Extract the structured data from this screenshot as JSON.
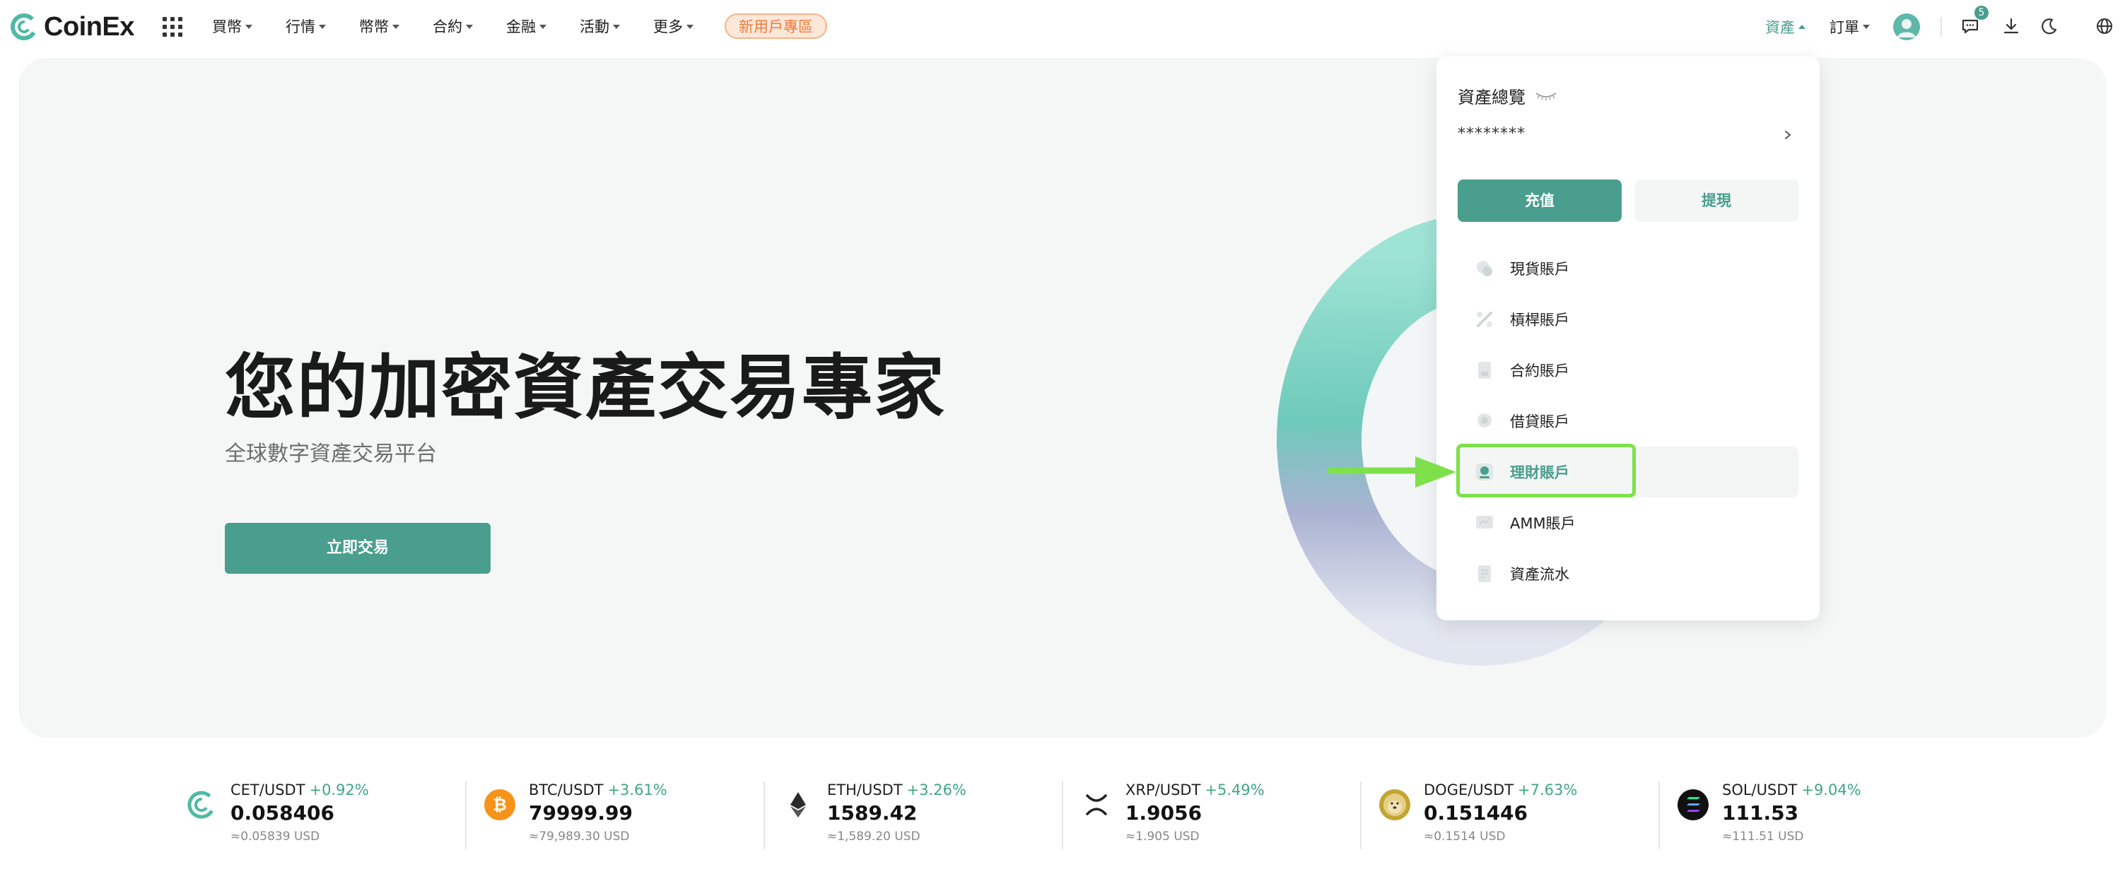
{
  "brand": {
    "name": "CoinEx",
    "color": "#4a9e8e"
  },
  "nav": {
    "items": [
      "買幣",
      "行情",
      "幣幣",
      "合約",
      "金融",
      "活動",
      "更多"
    ],
    "promo": "新用戶專區",
    "right": {
      "assets": "資產",
      "orders": "訂單",
      "notification_count": "5"
    }
  },
  "hero": {
    "title": "您的加密資產交易專家",
    "subtitle": "全球數字資產交易平台",
    "cta": "立即交易"
  },
  "assets_dropdown": {
    "title": "資產總覽",
    "balance": "********",
    "deposit": "充值",
    "withdraw": "提現",
    "accounts": [
      {
        "label": "現貨賬戶",
        "icon": "spot-account-icon"
      },
      {
        "label": "槓桿賬戶",
        "icon": "margin-account-icon"
      },
      {
        "label": "合約賬戶",
        "icon": "futures-account-icon"
      },
      {
        "label": "借貸賬戶",
        "icon": "loan-account-icon"
      },
      {
        "label": "理財賬戶",
        "icon": "financial-account-icon",
        "active": true
      },
      {
        "label": "AMM賬戶",
        "icon": "amm-account-icon"
      },
      {
        "label": "資產流水",
        "icon": "asset-history-icon"
      }
    ]
  },
  "ticker": [
    {
      "pair": "CET/USDT",
      "change": "+0.92%",
      "price": "0.058406",
      "usd": "≈0.05839 USD",
      "icon": "cet-coin-icon"
    },
    {
      "pair": "BTC/USDT",
      "change": "+3.61%",
      "price": "79999.99",
      "usd": "≈79,989.30 USD",
      "icon": "btc-coin-icon"
    },
    {
      "pair": "ETH/USDT",
      "change": "+3.26%",
      "price": "1589.42",
      "usd": "≈1,589.20 USD",
      "icon": "eth-coin-icon"
    },
    {
      "pair": "XRP/USDT",
      "change": "+5.49%",
      "price": "1.9056",
      "usd": "≈1.905 USD",
      "icon": "xrp-coin-icon"
    },
    {
      "pair": "DOGE/USDT",
      "change": "+7.63%",
      "price": "0.151446",
      "usd": "≈0.1514 USD",
      "icon": "doge-coin-icon"
    },
    {
      "pair": "SOL/USDT",
      "change": "+9.04%",
      "price": "111.53",
      "usd": "≈111.51 USD",
      "icon": "sol-coin-icon"
    }
  ]
}
